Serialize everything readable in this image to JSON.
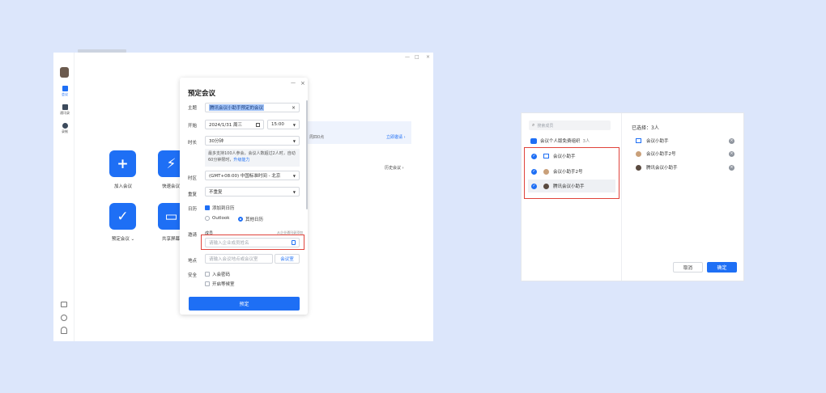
{
  "window": {
    "min_icon": "—",
    "max_icon": "□",
    "close_icon": "×"
  },
  "rail": {
    "items": [
      {
        "label": "会议"
      },
      {
        "label": "通讯录"
      },
      {
        "label": "录制"
      }
    ]
  },
  "tiles": [
    {
      "label": "加入会议",
      "icon": "plus-icon",
      "glyph": "+"
    },
    {
      "label": "快速会议",
      "icon": "lightning-icon",
      "glyph": "⚡"
    },
    {
      "label": "预定会议 ⌄",
      "icon": "check-icon",
      "glyph": "✓"
    },
    {
      "label": "共享屏幕",
      "icon": "screen-share-icon",
      "glyph": "▭"
    }
  ],
  "background": {
    "card_text": "周四0点",
    "card_link": "立即邀请 ›",
    "history": "历史会议 ›"
  },
  "dialog": {
    "title": "预定会议",
    "min": "—",
    "close": "×",
    "topic_label": "主题",
    "topic_value": "腾讯会议小助手预定的会议",
    "start_label": "开始",
    "start_date": "2024/1/31 周三",
    "start_time": "15:00",
    "duration_label": "时长",
    "duration_value": "30分钟",
    "note_text": "最多支持100人参会，会议人数超过2人时，自动60分钟限时，",
    "note_link": "升级能力",
    "timezone_label": "时区",
    "timezone_value": "(GMT+08:00) 中国标准时间 - 北京",
    "repeat_label": "重复",
    "repeat_value": "不重复",
    "calendar_label": "日历",
    "calendar_add": "添加到日历",
    "calendar_outlook": "Outlook",
    "calendar_other": "其他日历",
    "invite_label": "邀请",
    "invite_member": "成员",
    "invite_hint": "从企业通讯录添加",
    "invite_placeholder": "请输入企业成员姓名",
    "location_label": "地点",
    "location_placeholder": "请输入会议地点或会议室",
    "location_btn": "会议室",
    "security_label": "安全",
    "security_pwd": "入会密码",
    "security_waiting": "开启等候室",
    "submit": "预定"
  },
  "picker": {
    "search_placeholder": "搜索成员",
    "org_label": "会议个人版免费组织",
    "org_count": "3人",
    "members": [
      {
        "name": "会议小助手"
      },
      {
        "name": "会议小助手2号"
      },
      {
        "name": "腾讯会议小助手"
      }
    ],
    "selected_title": "已选择：3人",
    "selected": [
      {
        "name": "会议小助手"
      },
      {
        "name": "会议小助手2号"
      },
      {
        "name": "腾讯会议小助手"
      }
    ],
    "cancel": "取消",
    "confirm": "确定"
  },
  "colors": {
    "accent": "#1e6ff5",
    "highlight": "#e0433b",
    "page_bg": "#dce6fb"
  }
}
